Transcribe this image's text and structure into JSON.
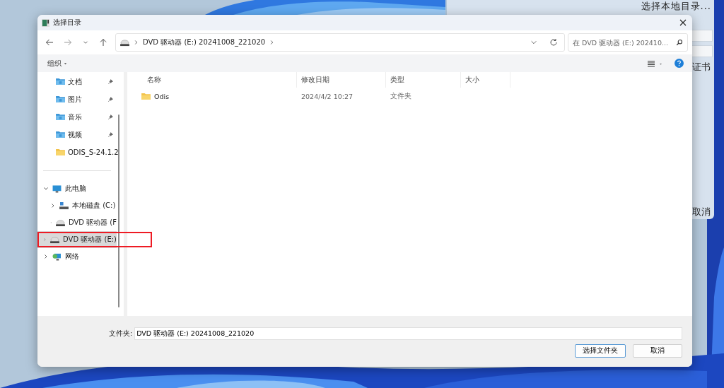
{
  "background_window": {
    "texts": [
      "选择本地目录...",
      "证书",
      "取消"
    ]
  },
  "dialog": {
    "title": "选择目录",
    "address": {
      "crumbs": [
        "DVD 驱动器 (E:) 20241008_221020"
      ]
    },
    "search": {
      "placeholder": "在 DVD 驱动器 (E:) 202410..."
    },
    "organize": "组织",
    "sidebar": {
      "quick_access": [
        {
          "label": "文档",
          "kind": "documents",
          "pinned": true
        },
        {
          "label": "图片",
          "kind": "pictures",
          "pinned": true
        },
        {
          "label": "音乐",
          "kind": "music",
          "pinned": true
        },
        {
          "label": "视频",
          "kind": "videos",
          "pinned": true
        },
        {
          "label": "ODIS_S-24.1.2",
          "kind": "folder",
          "pinned": false
        }
      ],
      "tree": [
        {
          "label": "此电脑",
          "kind": "pc",
          "expanded": true,
          "selected": false,
          "children": [
            {
              "label": "本地磁盘 (C:)",
              "kind": "disk",
              "expanded": false,
              "selected": false
            },
            {
              "label": "DVD 驱动器 (F",
              "kind": "dvd",
              "expanded": false,
              "selected": false
            }
          ]
        },
        {
          "label": "DVD 驱动器 (E:)",
          "kind": "dvd",
          "expanded": false,
          "selected": true
        },
        {
          "label": "网络",
          "kind": "network",
          "expanded": false,
          "selected": false
        }
      ]
    },
    "table": {
      "columns": [
        "名称",
        "修改日期",
        "类型",
        "大小"
      ],
      "rows": [
        {
          "name": "Odis",
          "modified": "2024/4/2 10:27",
          "type": "文件夹",
          "size_text": ""
        }
      ]
    },
    "folder_label": "文件夹:",
    "folder_value": "DVD 驱动器 (E:) 20241008_221020",
    "buttons": [
      "选择文件夹",
      "取消"
    ]
  }
}
